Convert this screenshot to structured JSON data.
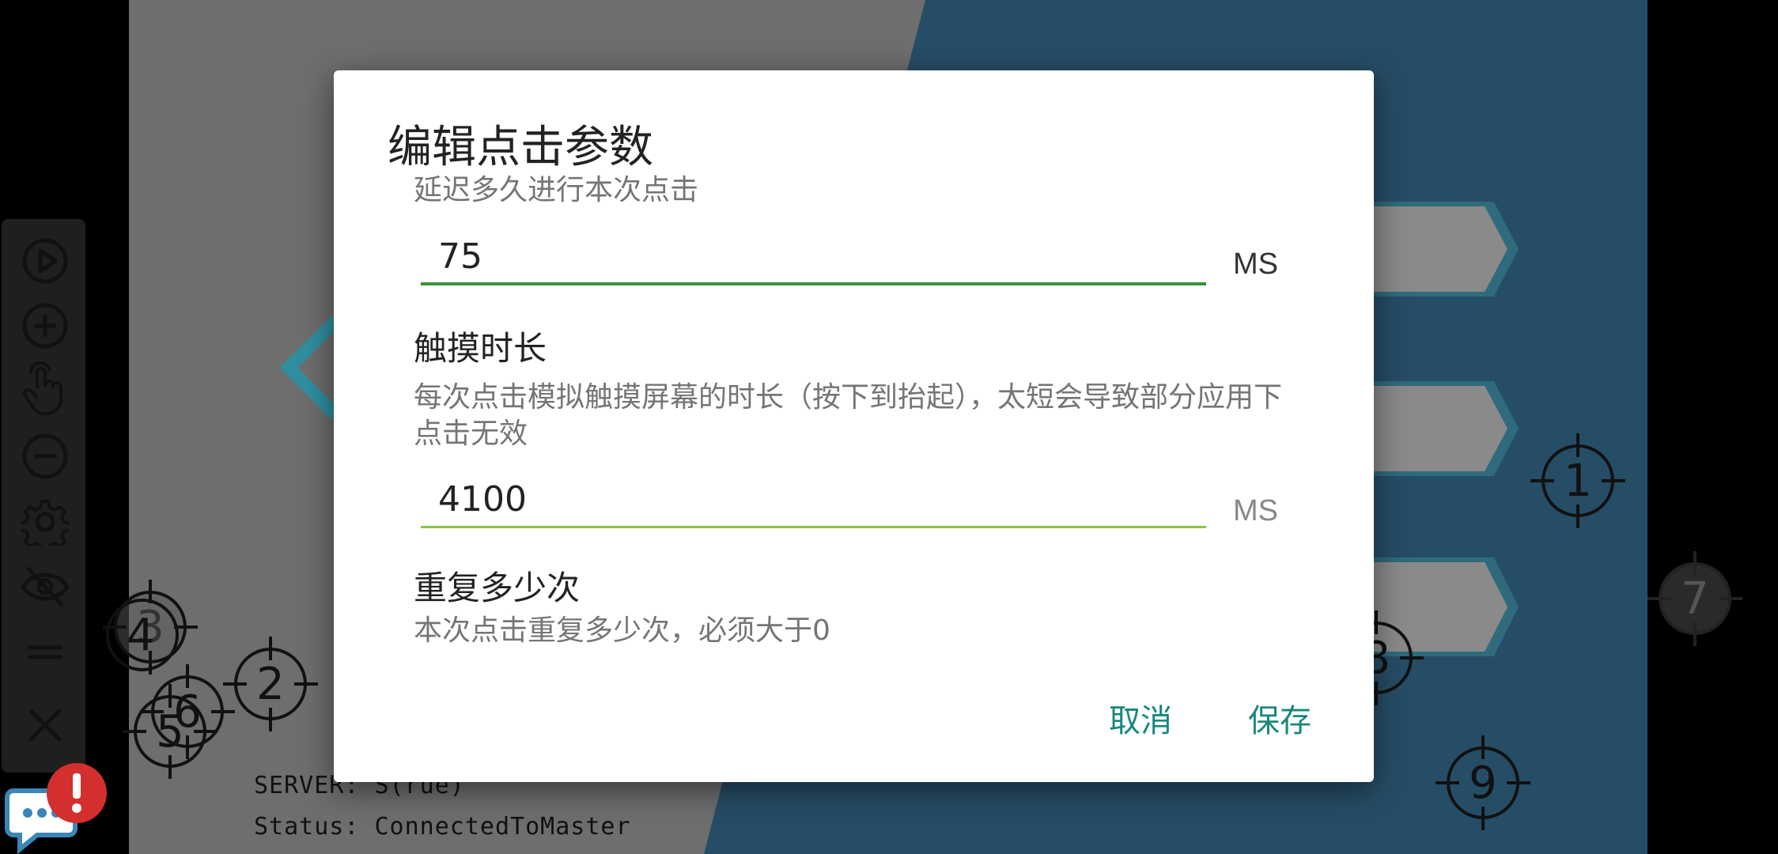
{
  "background": {
    "status_lines": [
      "SERVER: S(rue)",
      "Status: ConnectedToMaster"
    ],
    "targets": [
      "1",
      "2",
      "3",
      "4",
      "5",
      "6",
      "7",
      "8",
      "9"
    ]
  },
  "toolbar": {
    "items": [
      "play-icon",
      "add-circle-icon",
      "tap-hand-icon",
      "remove-circle-icon",
      "gear-icon",
      "eye-off-icon",
      "drag-handle-icon",
      "close-icon"
    ]
  },
  "dialog": {
    "title": "编辑点击参数",
    "delay": {
      "description": "延迟多久进行本次点击",
      "value": "75",
      "unit": "MS"
    },
    "touch": {
      "label": "触摸时长",
      "description": "每次点击模拟触摸屏幕的时长（按下到抬起），太短会导致部分应用下点击无效",
      "value": "4100",
      "unit": "MS"
    },
    "repeat": {
      "label": "重复多少次",
      "description": "本次点击重复多少次，必须大于0"
    },
    "cancel_label": "取消",
    "save_label": "保存"
  },
  "colors": {
    "accent": "#16887c",
    "focused_line": "#3c8f3e",
    "idle_line": "#8bc34a",
    "alert": "#d32f2f"
  }
}
